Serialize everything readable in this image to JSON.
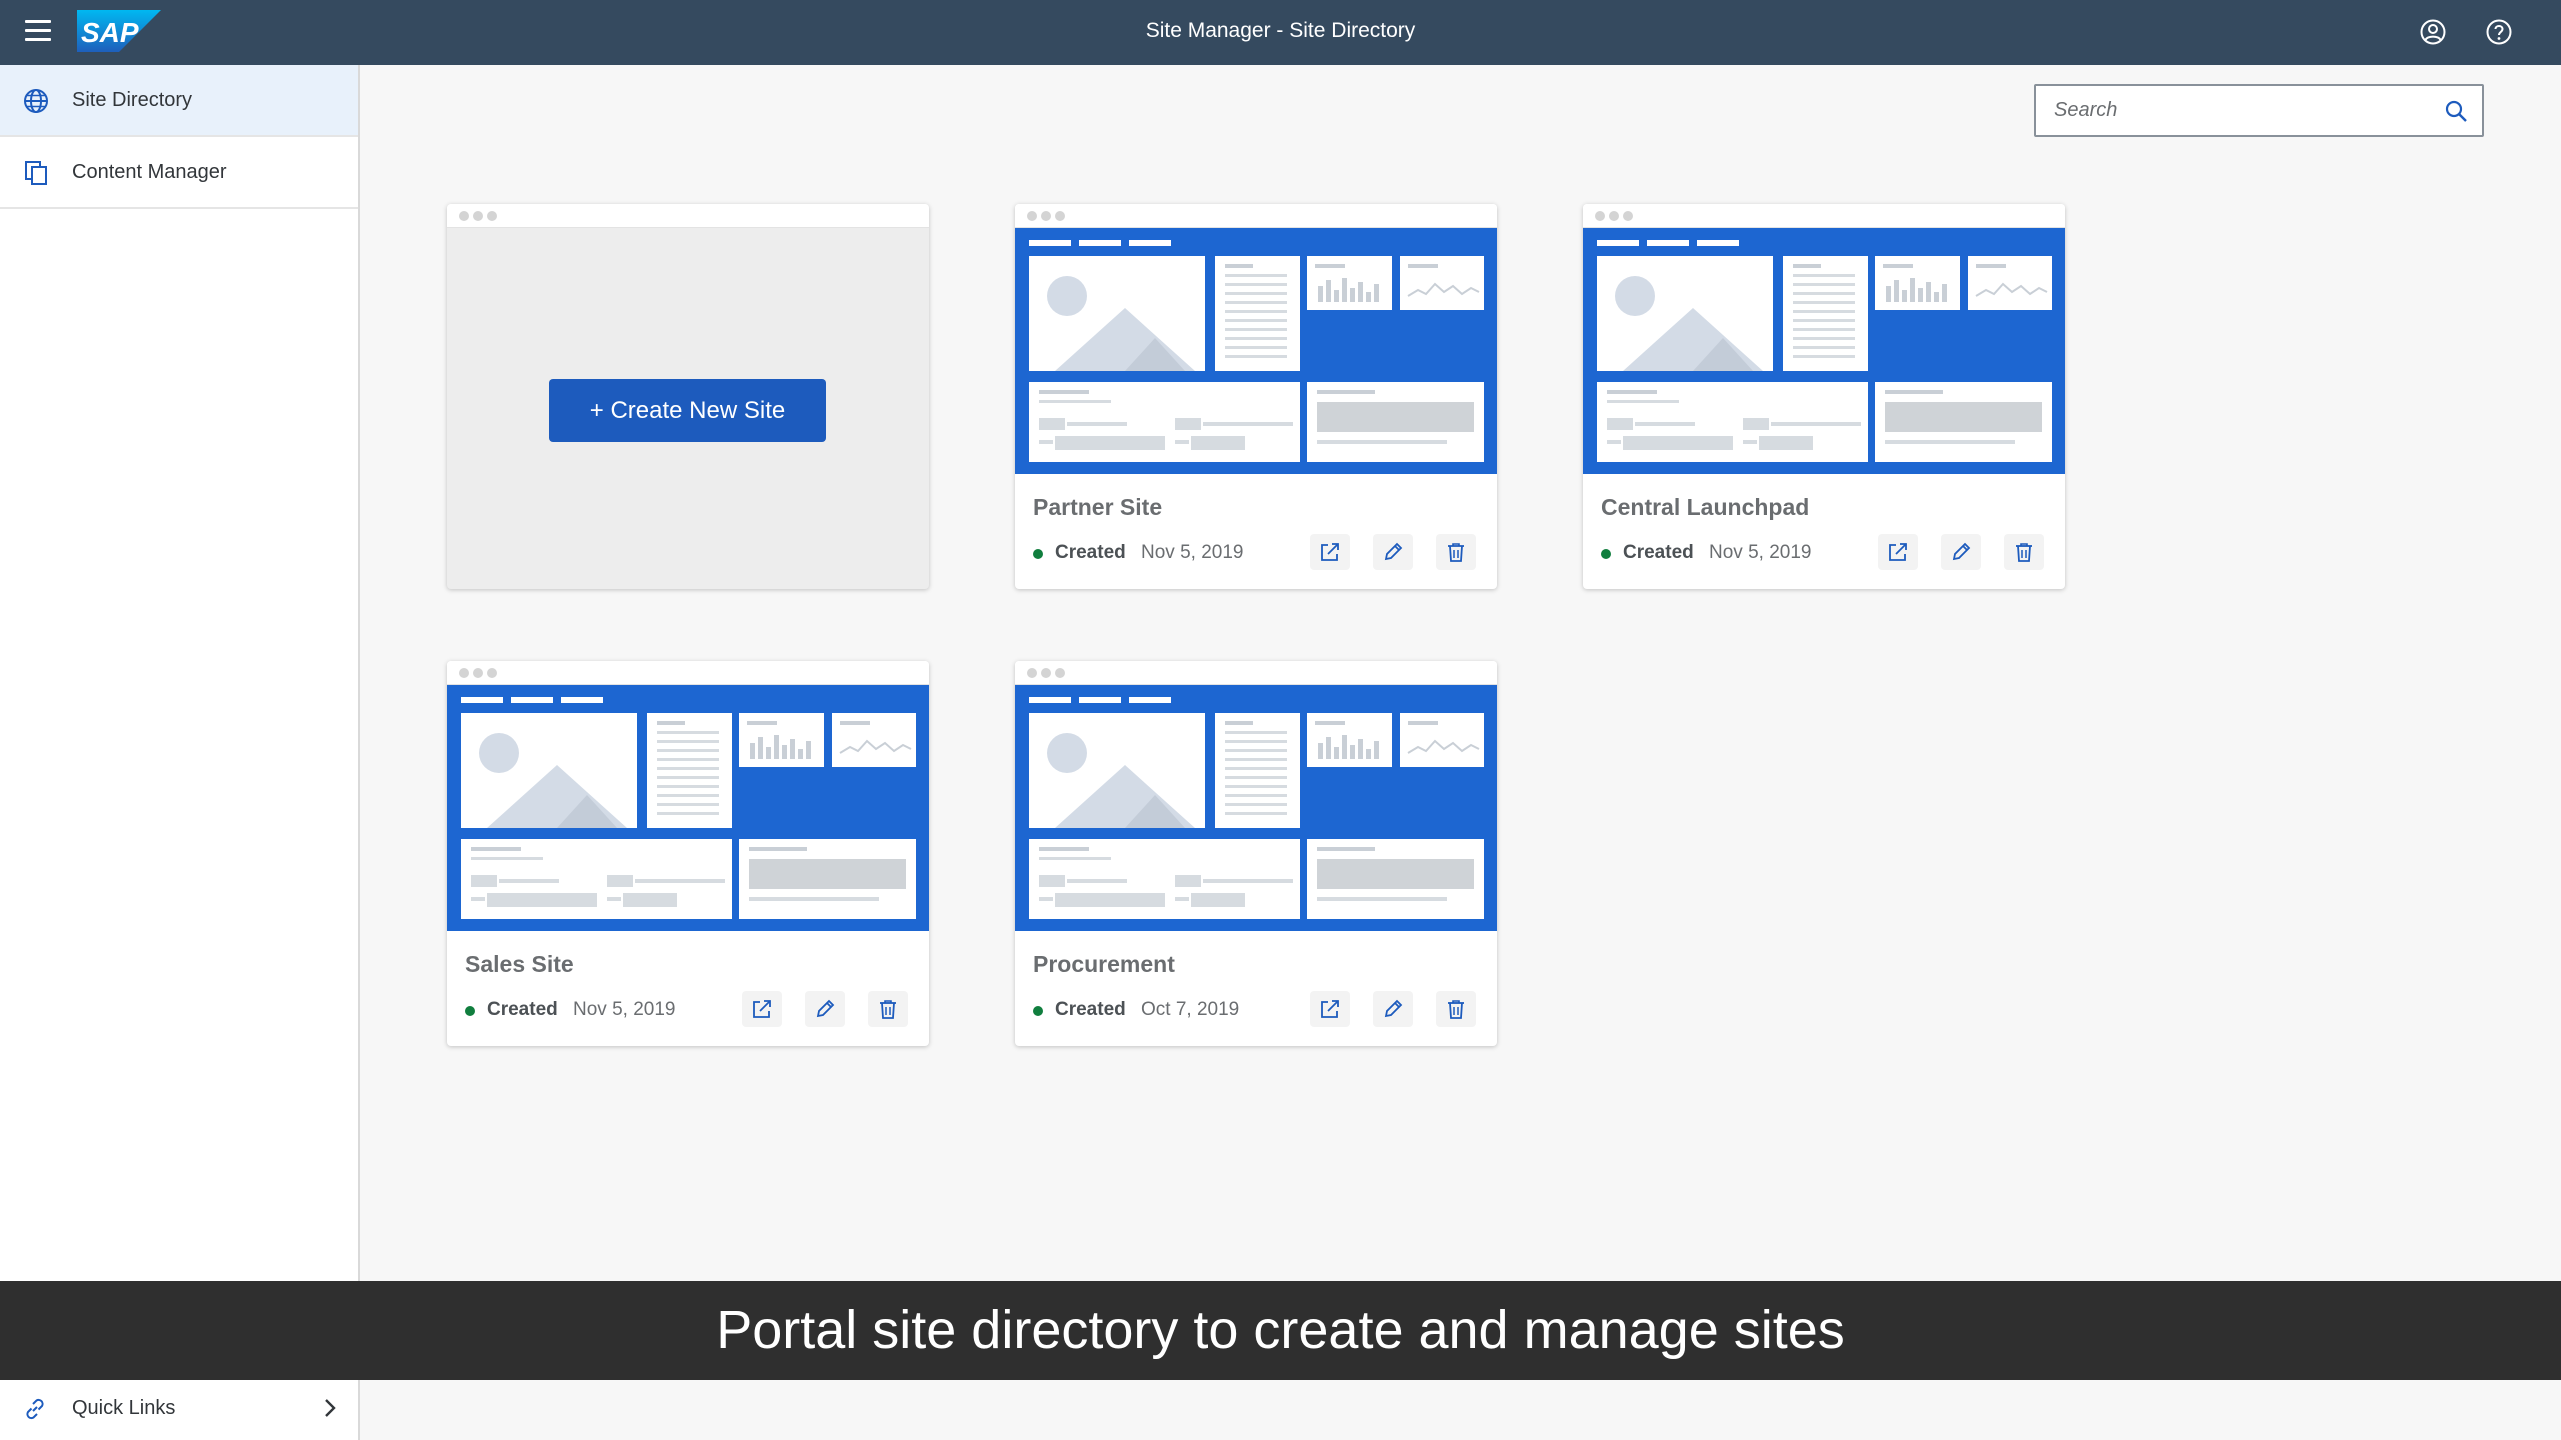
{
  "shell": {
    "title": "Site Manager - Site Directory",
    "logo_text": "SAP",
    "icons": [
      "menu-icon",
      "user-icon",
      "help-icon"
    ]
  },
  "sidenav": {
    "items": [
      {
        "label": "Site Directory",
        "icon": "globe-icon",
        "active": true
      },
      {
        "label": "Content Manager",
        "icon": "copy-icon",
        "active": false
      }
    ],
    "footer": {
      "label": "Quick Links",
      "icon": "link-icon"
    }
  },
  "search": {
    "placeholder": "Search"
  },
  "create_card": {
    "button_label": "+ Create New Site"
  },
  "sites": [
    {
      "name": "Partner Site",
      "status": "Created",
      "date": "Nov 5, 2019"
    },
    {
      "name": "Central Launchpad",
      "status": "Created",
      "date": "Nov 5, 2019"
    },
    {
      "name": "Sales Site",
      "status": "Created",
      "date": "Nov 5, 2019"
    },
    {
      "name": "Procurement",
      "status": "Created",
      "date": "Oct 7, 2019"
    }
  ],
  "caption": "Portal site directory to create and manage sites",
  "colors": {
    "shell": "#354a5f",
    "preview_blue": "#1d66d1",
    "button_blue": "#1d5bbd",
    "status_green": "#107e3e"
  }
}
